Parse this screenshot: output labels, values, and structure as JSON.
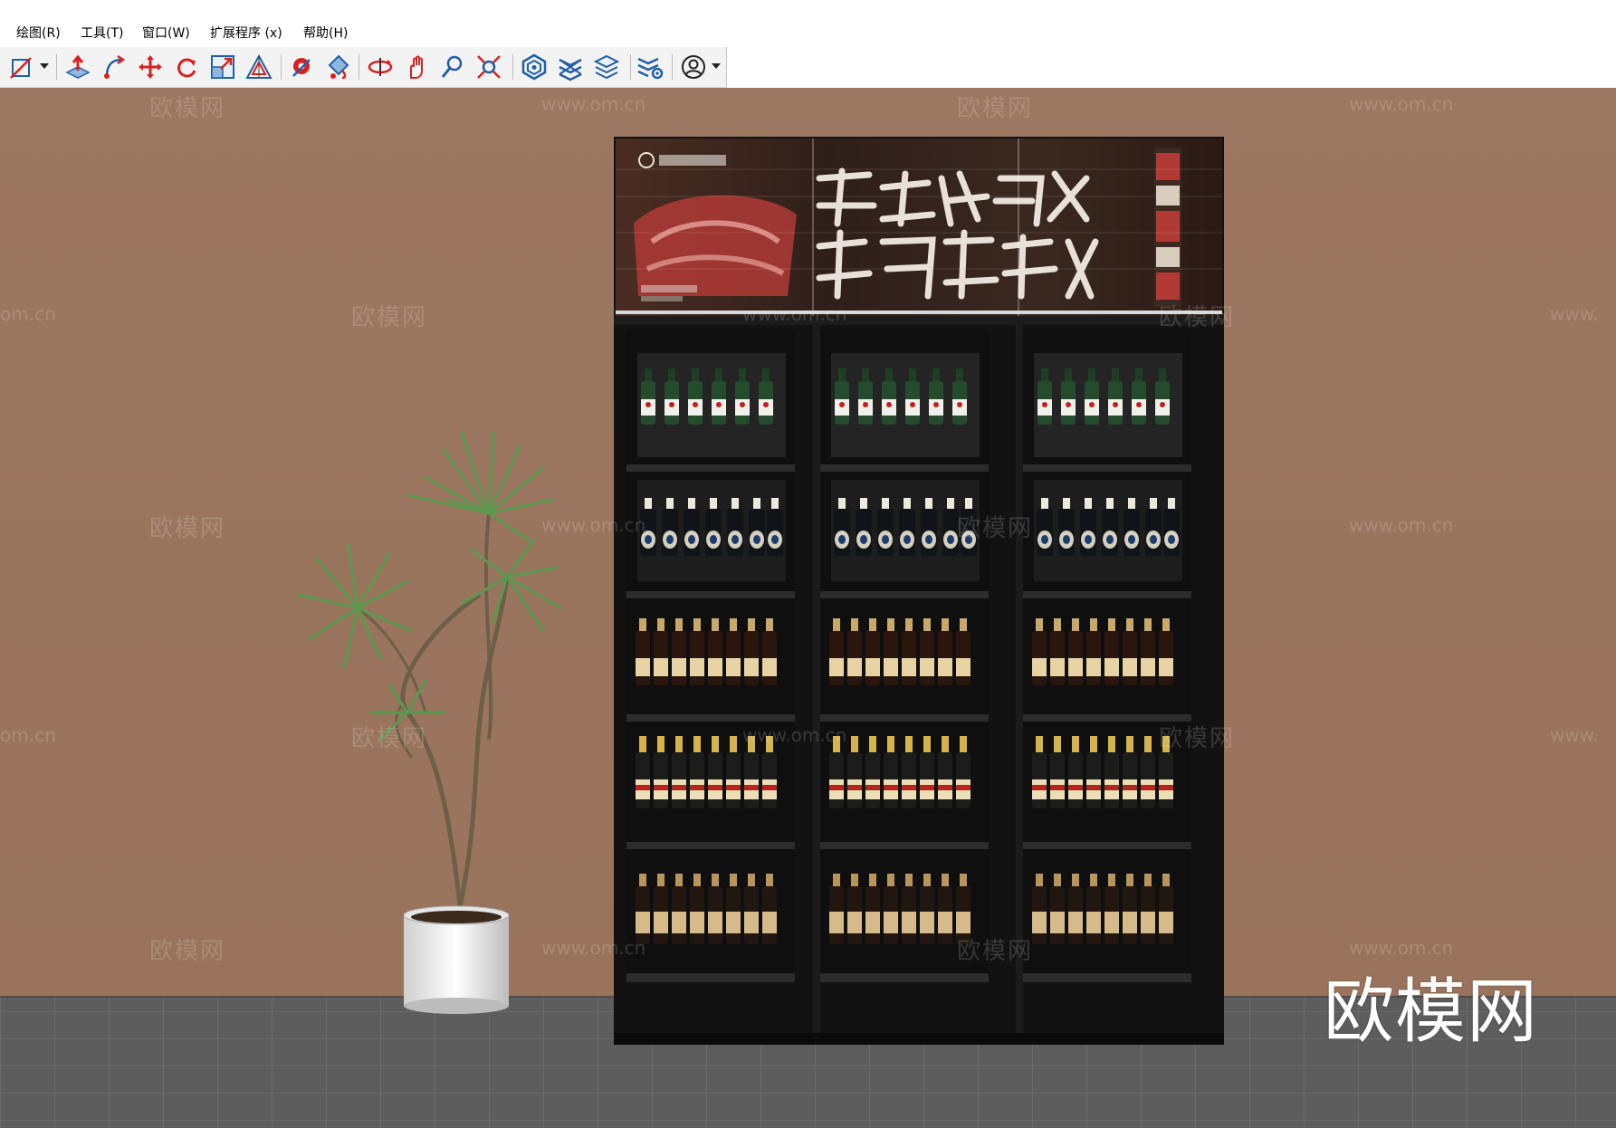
{
  "menu": {
    "items": [
      {
        "label": "绘图(R)"
      },
      {
        "label": "工具(T)"
      },
      {
        "label": "窗口(W)"
      },
      {
        "label": "扩展程序 (x)"
      },
      {
        "label": "帮助(H)"
      }
    ]
  },
  "toolbar": {
    "buttons": [
      {
        "icon": "line-tool-icon"
      },
      {
        "icon": "push-pull-icon"
      },
      {
        "icon": "follow-me-icon"
      },
      {
        "icon": "move-icon"
      },
      {
        "icon": "rotate-icon"
      },
      {
        "icon": "scale-icon"
      },
      {
        "icon": "offset-icon"
      },
      {
        "icon": "tape-measure-icon"
      },
      {
        "icon": "paint-bucket-icon"
      },
      {
        "icon": "orbit-icon"
      },
      {
        "icon": "pan-icon"
      },
      {
        "icon": "zoom-icon"
      },
      {
        "icon": "zoom-extents-icon"
      },
      {
        "icon": "warehouse-icon"
      },
      {
        "icon": "extension-warehouse-icon"
      },
      {
        "icon": "layer-manager-icon"
      },
      {
        "icon": "extension-settings-icon"
      },
      {
        "icon": "user-account-icon"
      }
    ]
  },
  "watermark": {
    "brand": "欧模网",
    "url": "www.om.cn",
    "url_partial_left": "om.cn",
    "url_partial_right": "www."
  },
  "colors": {
    "wall": "#9b7660",
    "floor": "#5d5d5d",
    "cabinet": "#151515",
    "accent_red": "#d8201f",
    "accent_blue": "#1f5fa8"
  }
}
